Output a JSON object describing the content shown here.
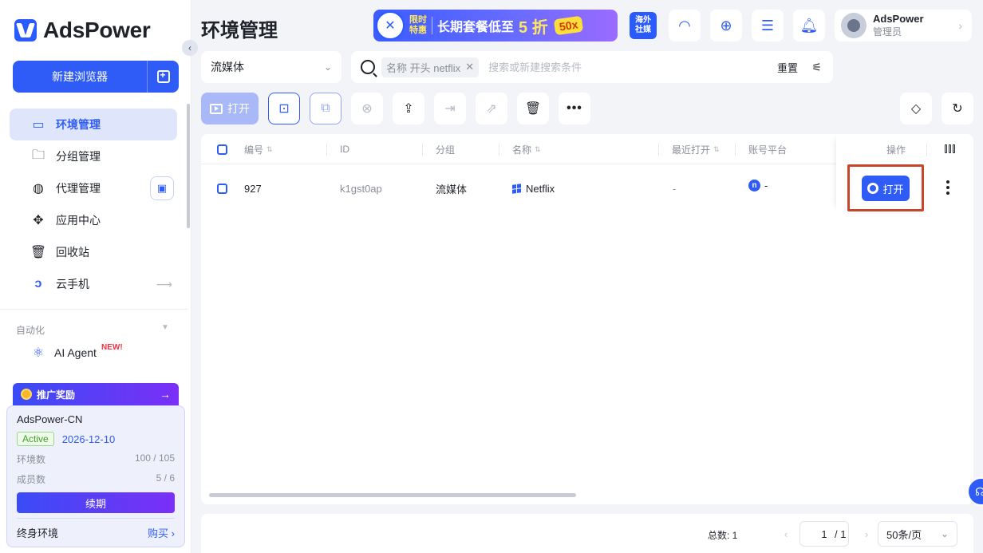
{
  "app": {
    "name": "AdsPower"
  },
  "sidebar": {
    "new_browser_label": "新建浏览器",
    "items": [
      {
        "label": "环境管理",
        "icon": "browser-window-icon",
        "active": true
      },
      {
        "label": "分组管理",
        "icon": "folder-icon"
      },
      {
        "label": "代理管理",
        "icon": "globe-icon"
      },
      {
        "label": "应用中心",
        "icon": "puzzle-icon"
      },
      {
        "label": "回收站",
        "icon": "trash-icon"
      },
      {
        "label": "云手机",
        "icon": "cloud-phone-icon"
      }
    ],
    "section_label": "自动化",
    "ai_agent": {
      "label": "AI Agent",
      "badge": "NEW!"
    },
    "promo": {
      "label": "推广奖励",
      "arrow": "→"
    },
    "account": {
      "name": "AdsPower-CN",
      "status": "Active",
      "expiry": "2026-12-10",
      "env_label": "环境数",
      "env_value": "100 / 105",
      "member_label": "成员数",
      "member_value": "5 / 6",
      "renew_label": "续期",
      "lifetime_label": "终身环境",
      "buy_label": "购买 ›"
    }
  },
  "header": {
    "title": "环境管理",
    "banner": {
      "badge": "✕",
      "tag_line1": "限时",
      "tag_line2": "特惠",
      "text": "长期套餐低至",
      "big": "5 折",
      "off": "50x"
    },
    "media_label_line1": "海外",
    "media_label_line2": "社媒",
    "user": {
      "name": "AdsPower",
      "role": "管理员"
    }
  },
  "filters": {
    "group_value": "流媒体",
    "chip": "名称 开头 netflix",
    "search_placeholder": "搜索或新建搜索条件",
    "reset_label": "重置"
  },
  "toolbar": {
    "open_label": "打开"
  },
  "table": {
    "headers": {
      "number": "编号",
      "id": "ID",
      "group": "分组",
      "name": "名称",
      "last_open": "最近打开",
      "platform": "账号平台",
      "ops": "操作"
    },
    "rows": [
      {
        "number": "927",
        "id": "k1gst0ap",
        "group": "流媒体",
        "name": "Netflix",
        "last_open": "-",
        "platform_icon": "n",
        "platform": "-",
        "open_label": "打开"
      }
    ]
  },
  "pagination": {
    "total": "总数: 1",
    "prev": "‹",
    "page": "1",
    "of": "/ 1",
    "next": "›",
    "page_size": "50条/页"
  },
  "colors": {
    "primary": "#2f5cf6",
    "highlight_border": "#c8442b",
    "active_green": "#3f9f2a"
  }
}
